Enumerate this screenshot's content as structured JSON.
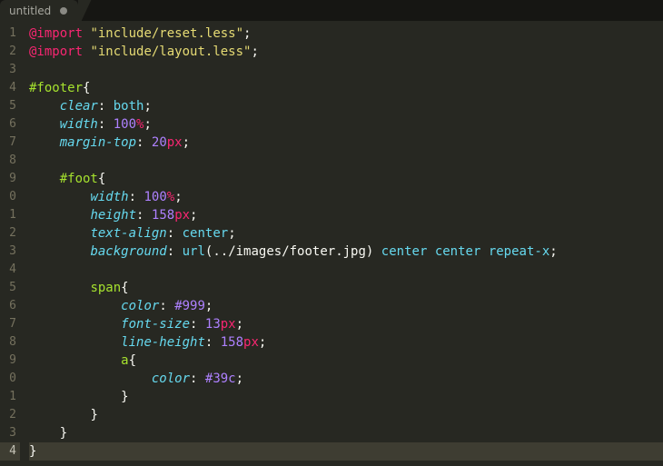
{
  "tab": {
    "title": "untitled",
    "dirty": true
  },
  "editor": {
    "cursor_line": 24,
    "lines": [
      {
        "n": "1",
        "tokens": [
          [
            "kw",
            "@import"
          ],
          [
            "plain",
            " "
          ],
          [
            "str",
            "\"include/reset.less\""
          ],
          [
            "punct",
            ";"
          ]
        ]
      },
      {
        "n": "2",
        "tokens": [
          [
            "kw",
            "@import"
          ],
          [
            "plain",
            " "
          ],
          [
            "str",
            "\"include/layout.less\""
          ],
          [
            "punct",
            ";"
          ]
        ]
      },
      {
        "n": "3",
        "tokens": []
      },
      {
        "n": "4",
        "tokens": [
          [
            "sel",
            "#footer"
          ],
          [
            "punct",
            "{"
          ]
        ]
      },
      {
        "n": "5",
        "tokens": [
          [
            "plain",
            "    "
          ],
          [
            "prop",
            "clear"
          ],
          [
            "punct",
            ":"
          ],
          [
            "plain",
            " "
          ],
          [
            "val",
            "both"
          ],
          [
            "punct",
            ";"
          ]
        ]
      },
      {
        "n": "6",
        "tokens": [
          [
            "plain",
            "    "
          ],
          [
            "prop",
            "width"
          ],
          [
            "punct",
            ":"
          ],
          [
            "plain",
            " "
          ],
          [
            "num",
            "100"
          ],
          [
            "unit",
            "%"
          ],
          [
            "punct",
            ";"
          ]
        ]
      },
      {
        "n": "7",
        "tokens": [
          [
            "plain",
            "    "
          ],
          [
            "prop",
            "margin-top"
          ],
          [
            "punct",
            ":"
          ],
          [
            "plain",
            " "
          ],
          [
            "num",
            "20"
          ],
          [
            "unit",
            "px"
          ],
          [
            "punct",
            ";"
          ]
        ]
      },
      {
        "n": "8",
        "tokens": []
      },
      {
        "n": "9",
        "tokens": [
          [
            "plain",
            "    "
          ],
          [
            "sel",
            "#foot"
          ],
          [
            "punct",
            "{"
          ]
        ]
      },
      {
        "n": "0",
        "tokens": [
          [
            "plain",
            "        "
          ],
          [
            "prop",
            "width"
          ],
          [
            "punct",
            ":"
          ],
          [
            "plain",
            " "
          ],
          [
            "num",
            "100"
          ],
          [
            "unit",
            "%"
          ],
          [
            "punct",
            ";"
          ]
        ]
      },
      {
        "n": "1",
        "tokens": [
          [
            "plain",
            "        "
          ],
          [
            "prop",
            "height"
          ],
          [
            "punct",
            ":"
          ],
          [
            "plain",
            " "
          ],
          [
            "num",
            "158"
          ],
          [
            "unit",
            "px"
          ],
          [
            "punct",
            ";"
          ]
        ]
      },
      {
        "n": "2",
        "tokens": [
          [
            "plain",
            "        "
          ],
          [
            "prop",
            "text-align"
          ],
          [
            "punct",
            ":"
          ],
          [
            "plain",
            " "
          ],
          [
            "val",
            "center"
          ],
          [
            "punct",
            ";"
          ]
        ]
      },
      {
        "n": "3",
        "tokens": [
          [
            "plain",
            "        "
          ],
          [
            "prop",
            "background"
          ],
          [
            "punct",
            ":"
          ],
          [
            "plain",
            " "
          ],
          [
            "val",
            "url"
          ],
          [
            "punct",
            "("
          ],
          [
            "plain",
            "../images/footer.jpg"
          ],
          [
            "punct",
            ")"
          ],
          [
            "plain",
            " "
          ],
          [
            "val",
            "center"
          ],
          [
            "plain",
            " "
          ],
          [
            "val",
            "center"
          ],
          [
            "plain",
            " "
          ],
          [
            "val",
            "repeat-x"
          ],
          [
            "punct",
            ";"
          ]
        ]
      },
      {
        "n": "4",
        "tokens": []
      },
      {
        "n": "5",
        "tokens": [
          [
            "plain",
            "        "
          ],
          [
            "sel",
            "span"
          ],
          [
            "punct",
            "{"
          ]
        ]
      },
      {
        "n": "6",
        "tokens": [
          [
            "plain",
            "            "
          ],
          [
            "prop",
            "color"
          ],
          [
            "punct",
            ":"
          ],
          [
            "plain",
            " "
          ],
          [
            "num",
            "#999"
          ],
          [
            "punct",
            ";"
          ]
        ]
      },
      {
        "n": "7",
        "tokens": [
          [
            "plain",
            "            "
          ],
          [
            "prop",
            "font-size"
          ],
          [
            "punct",
            ":"
          ],
          [
            "plain",
            " "
          ],
          [
            "num",
            "13"
          ],
          [
            "unit",
            "px"
          ],
          [
            "punct",
            ";"
          ]
        ]
      },
      {
        "n": "8",
        "tokens": [
          [
            "plain",
            "            "
          ],
          [
            "prop",
            "line-height"
          ],
          [
            "punct",
            ":"
          ],
          [
            "plain",
            " "
          ],
          [
            "num",
            "158"
          ],
          [
            "unit",
            "px"
          ],
          [
            "punct",
            ";"
          ]
        ]
      },
      {
        "n": "9",
        "tokens": [
          [
            "plain",
            "            "
          ],
          [
            "sel",
            "a"
          ],
          [
            "punct",
            "{"
          ]
        ]
      },
      {
        "n": "0",
        "tokens": [
          [
            "plain",
            "                "
          ],
          [
            "prop",
            "color"
          ],
          [
            "punct",
            ":"
          ],
          [
            "plain",
            " "
          ],
          [
            "num",
            "#39c"
          ],
          [
            "punct",
            ";"
          ]
        ]
      },
      {
        "n": "1",
        "tokens": [
          [
            "plain",
            "            "
          ],
          [
            "punct",
            "}"
          ]
        ]
      },
      {
        "n": "2",
        "tokens": [
          [
            "plain",
            "        "
          ],
          [
            "punct",
            "}"
          ]
        ]
      },
      {
        "n": "3",
        "tokens": [
          [
            "plain",
            "    "
          ],
          [
            "punct",
            "}"
          ]
        ]
      },
      {
        "n": "4",
        "tokens": [
          [
            "punct",
            "}"
          ]
        ]
      }
    ]
  }
}
